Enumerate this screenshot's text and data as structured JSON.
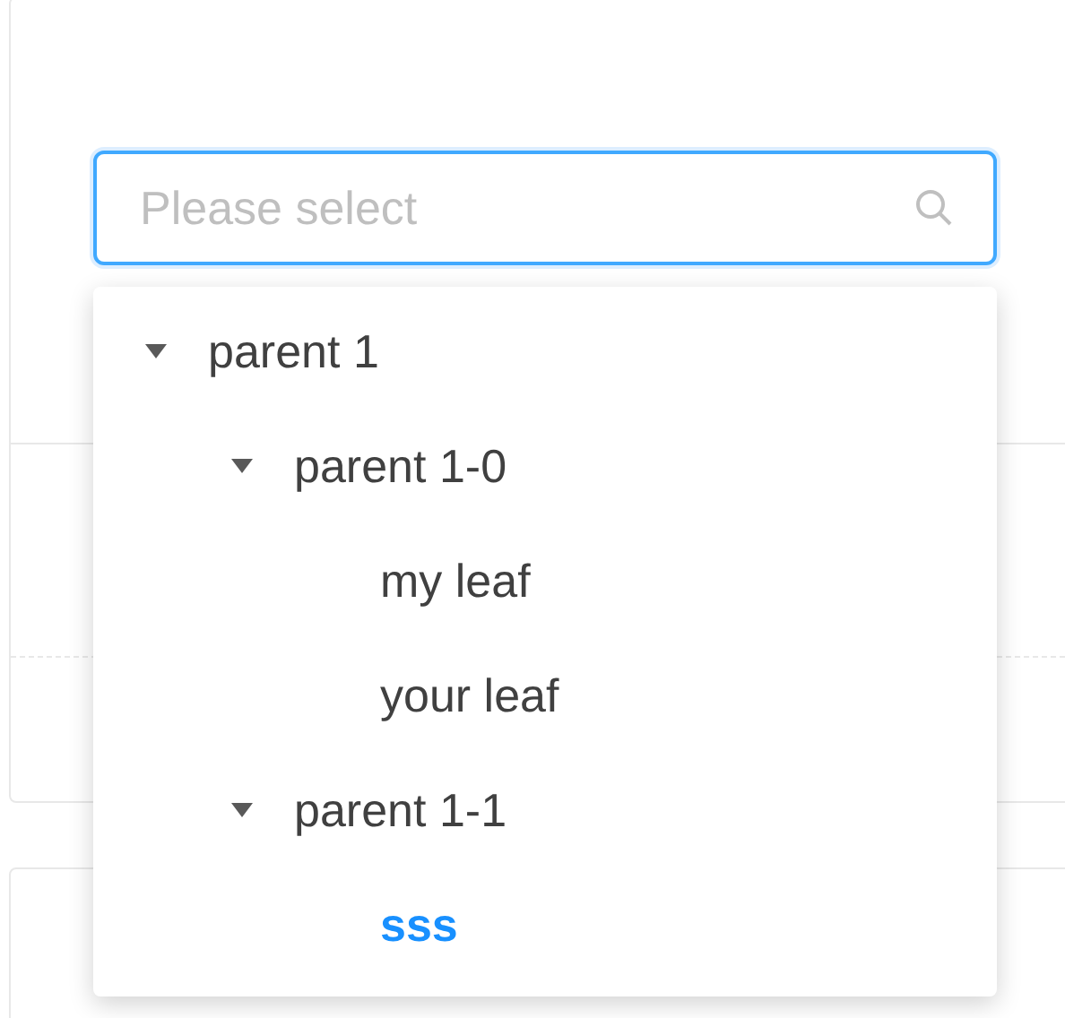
{
  "select": {
    "placeholder": "Please select"
  },
  "tree": [
    {
      "label": "parent 1",
      "expanded": true,
      "selected": false,
      "children": [
        {
          "label": "parent 1-0",
          "expanded": true,
          "selected": false,
          "children": [
            {
              "label": "my leaf",
              "selected": false
            },
            {
              "label": "your leaf",
              "selected": false
            }
          ]
        },
        {
          "label": "parent 1-1",
          "expanded": true,
          "selected": false,
          "children": [
            {
              "label": "sss",
              "selected": true
            }
          ]
        }
      ]
    }
  ]
}
